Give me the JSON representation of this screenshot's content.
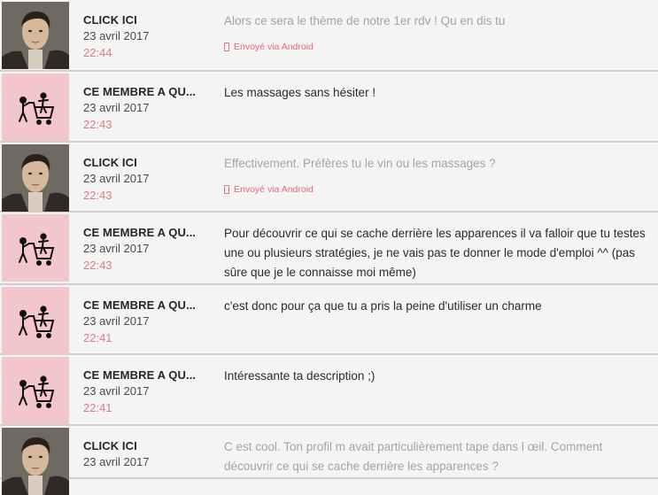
{
  "messages": [
    {
      "sender": "CLICK ICI",
      "avatar": "man-photo",
      "date": "23 avril 2017",
      "time": "22:44",
      "text": "Alors ce sera le thème de notre 1er rdv ! Qu en dis tu",
      "faded": true,
      "via": "Envoyé via Android"
    },
    {
      "sender": "CE MEMBRE A QU...",
      "avatar": "shopping-cart-pictogram",
      "date": "23 avril 2017",
      "time": "22:43",
      "text": "Les massages sans hésiter !",
      "faded": false,
      "via": ""
    },
    {
      "sender": "CLICK ICI",
      "avatar": "man-photo",
      "date": "23 avril 2017",
      "time": "22:43",
      "text": "Effectivement. Préfères tu le vin ou les massages ?",
      "faded": true,
      "via": "Envoyé via Android"
    },
    {
      "sender": "CE MEMBRE A QU...",
      "avatar": "shopping-cart-pictogram",
      "date": "23 avril 2017",
      "time": "22:43",
      "text": "Pour découvrir ce qui se cache derrière les apparences il va falloir que tu testes une ou plusieurs stratégies, je ne vais pas te donner le mode d'emploi ^^ (pas sûre que je le connaisse moi même)",
      "faded": false,
      "via": ""
    },
    {
      "sender": "CE MEMBRE A QU...",
      "avatar": "shopping-cart-pictogram",
      "date": "23 avril 2017",
      "time": "22:41",
      "text": "c'est donc pour ça que tu a pris la peine d'utiliser un charme",
      "faded": false,
      "via": ""
    },
    {
      "sender": "CE MEMBRE A QU...",
      "avatar": "shopping-cart-pictogram",
      "date": "23 avril 2017",
      "time": "22:41",
      "text": "Intéressante ta description ;)",
      "faded": false,
      "via": ""
    },
    {
      "sender": "CLICK ICI",
      "avatar": "man-photo",
      "date": "23 avril 2017",
      "time": "",
      "text": "C est cool. Ton profil m avait particulièrement tape dans l œil. Comment découvrir ce qui se cache derrière les apparences ?",
      "faded": true,
      "via": ""
    }
  ]
}
